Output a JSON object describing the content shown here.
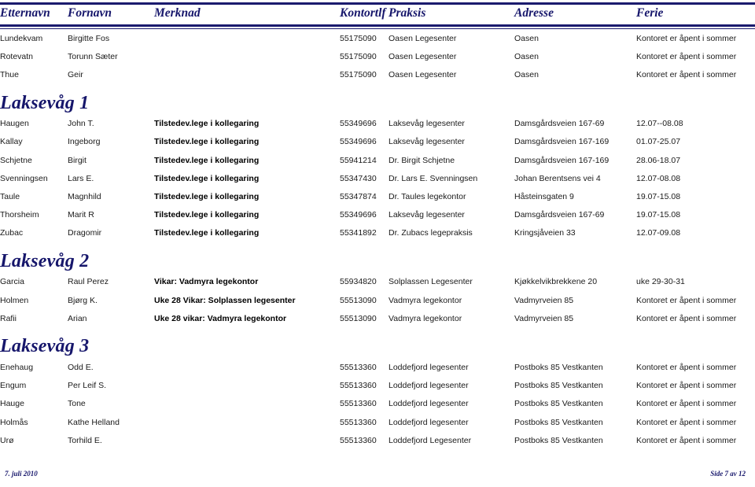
{
  "document": {
    "columns": [
      {
        "key": "etternavn",
        "label": "Etternavn"
      },
      {
        "key": "fornavn",
        "label": "Fornavn"
      },
      {
        "key": "merknad",
        "label": "Merknad"
      },
      {
        "key": "kontortlf",
        "label": "Kontortlf"
      },
      {
        "key": "praksis",
        "label": "Praksis"
      },
      {
        "key": "adresse",
        "label": "Adresse"
      },
      {
        "key": "ferie",
        "label": "Ferie"
      }
    ],
    "accent_color": "#16166b",
    "rule_color": "#1b1b6e"
  },
  "rows": [
    {
      "type": "data",
      "etternavn": "Lundekvam",
      "fornavn": "Birgitte Fos",
      "merknad": "",
      "kontortlf": "55175090",
      "praksis": "Oasen Legesenter",
      "adresse": "Oasen",
      "ferie": "Kontoret er åpent i sommer"
    },
    {
      "type": "data",
      "etternavn": "Rotevatn",
      "fornavn": "Torunn Sæter",
      "merknad": "",
      "kontortlf": "55175090",
      "praksis": "Oasen Legesenter",
      "adresse": "Oasen",
      "ferie": "Kontoret er åpent i sommer"
    },
    {
      "type": "data",
      "etternavn": "Thue",
      "fornavn": "Geir",
      "merknad": "",
      "kontortlf": "55175090",
      "praksis": "Oasen Legesenter",
      "adresse": "Oasen",
      "ferie": "Kontoret er åpent i sommer"
    },
    {
      "type": "group",
      "title": "Laksevåg 1"
    },
    {
      "type": "data",
      "etternavn": "Haugen",
      "fornavn": "John T.",
      "merknad": "Tilstedev.lege i kollegaring",
      "kontortlf": "55349696",
      "praksis": "Laksevåg legesenter",
      "adresse": "Damsgårdsveien 167-69",
      "ferie": "12.07--08.08"
    },
    {
      "type": "data",
      "etternavn": "Kallay",
      "fornavn": "Ingeborg",
      "merknad": "Tilstedev.lege i kollegaring",
      "kontortlf": "55349696",
      "praksis": "Laksevåg legesenter",
      "adresse": "Damsgårdsveien 167-169",
      "ferie": "01.07-25.07"
    },
    {
      "type": "data",
      "etternavn": "Schjetne",
      "fornavn": "Birgit",
      "merknad": "Tilstedev.lege i kollegaring",
      "kontortlf": "55941214",
      "praksis": "Dr. Birgit Schjetne",
      "adresse": "Damsgårdsveien 167-169",
      "ferie": "28.06-18.07"
    },
    {
      "type": "data",
      "etternavn": "Svenningsen",
      "fornavn": "Lars E.",
      "merknad": "Tilstedev.lege i kollegaring",
      "kontortlf": "55347430",
      "praksis": "Dr. Lars E. Svenningsen",
      "adresse": "Johan Berentsens vei 4",
      "ferie": "12.07-08.08"
    },
    {
      "type": "data",
      "etternavn": "Taule",
      "fornavn": "Magnhild",
      "merknad": "Tilstedev.lege i kollegaring",
      "kontortlf": "55347874",
      "praksis": "Dr. Taules  legekontor",
      "adresse": "Håsteinsgaten 9",
      "ferie": "19.07-15.08"
    },
    {
      "type": "data",
      "etternavn": "Thorsheim",
      "fornavn": "Marit R",
      "merknad": "Tilstedev.lege i kollegaring",
      "kontortlf": "55349696",
      "praksis": "Laksevåg legesenter",
      "adresse": "Damsgårdsveien 167-69",
      "ferie": "19.07-15.08"
    },
    {
      "type": "data",
      "etternavn": "Zubac",
      "fornavn": "Dragomir",
      "merknad": "Tilstedev.lege i kollegaring",
      "kontortlf": "55341892",
      "praksis": "Dr. Zubacs legepraksis",
      "adresse": "Kringsjåveien 33",
      "ferie": "12.07-09.08"
    },
    {
      "type": "group",
      "title": "Laksevåg 2"
    },
    {
      "type": "data",
      "etternavn": "Garcia",
      "fornavn": "Raul Perez",
      "merknad": "Vikar: Vadmyra legekontor",
      "kontortlf": "55934820",
      "praksis": "Solplassen Legesenter",
      "adresse": "Kjøkkelvikbrekkene 20",
      "ferie": "uke 29-30-31"
    },
    {
      "type": "data",
      "etternavn": "Holmen",
      "fornavn": "Bjørg K.",
      "merknad": "Uke 28 Vikar: Solplassen legesenter",
      "kontortlf": "55513090",
      "praksis": "Vadmyra legekontor",
      "adresse": "Vadmyrveien 85",
      "ferie": "Kontoret er åpent i sommer"
    },
    {
      "type": "data",
      "etternavn": "Rafii",
      "fornavn": "Arian",
      "merknad": "Uke 28 vikar: Vadmyra legekontor",
      "kontortlf": "55513090",
      "praksis": "Vadmyra legekontor",
      "adresse": "Vadmyrveien 85",
      "ferie": "Kontoret er åpent i sommer"
    },
    {
      "type": "group",
      "title": "Laksevåg 3"
    },
    {
      "type": "data",
      "etternavn": "Enehaug",
      "fornavn": "Odd E.",
      "merknad": "",
      "kontortlf": "55513360",
      "praksis": "Loddefjord legesenter",
      "adresse": "Postboks 85 Vestkanten",
      "ferie": "Kontoret er åpent i sommer"
    },
    {
      "type": "data",
      "etternavn": "Engum",
      "fornavn": "Per Leif S.",
      "merknad": "",
      "kontortlf": "55513360",
      "praksis": "Loddefjord legesenter",
      "adresse": "Postboks 85 Vestkanten",
      "ferie": "Kontoret er åpent i sommer"
    },
    {
      "type": "data",
      "etternavn": "Hauge",
      "fornavn": "Tone",
      "merknad": "",
      "kontortlf": "55513360",
      "praksis": "Loddefjord legesenter",
      "adresse": "Postboks 85 Vestkanten",
      "ferie": "Kontoret er åpent i sommer"
    },
    {
      "type": "data",
      "etternavn": "Holmås",
      "fornavn": "Kathe Helland",
      "merknad": "",
      "kontortlf": "55513360",
      "praksis": "Loddefjord legesenter",
      "adresse": "Postboks 85 Vestkanten",
      "ferie": "Kontoret er åpent i sommer"
    },
    {
      "type": "data",
      "etternavn": "Urø",
      "fornavn": "Torhild E.",
      "merknad": "",
      "kontortlf": "55513360",
      "praksis": "Loddefjord Legesenter",
      "adresse": "Postboks 85 Vestkanten",
      "ferie": "Kontoret er åpent i sommer"
    }
  ],
  "footer": {
    "date": "7. juli 2010",
    "page": "Side 7 av 12"
  }
}
